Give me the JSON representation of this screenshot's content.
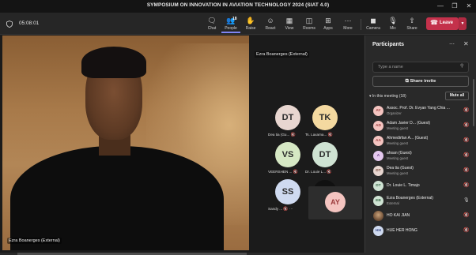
{
  "window": {
    "title": "SYMPOSIUM ON INNOVATION IN AVIATION TECHNOLOGY 2024 (SIAT 4.0)",
    "controls": [
      "—",
      "❐",
      "✕"
    ]
  },
  "toolbar": {
    "timer": "05:08:01",
    "buttons": [
      {
        "label": "Chat",
        "icon": "chat-icon"
      },
      {
        "label": "People",
        "icon": "people-icon",
        "count": "18"
      },
      {
        "label": "Raise",
        "icon": "hand-icon"
      },
      {
        "label": "React",
        "icon": "smile-icon"
      },
      {
        "label": "View",
        "icon": "view-icon"
      },
      {
        "label": "Rooms",
        "icon": "rooms-icon"
      },
      {
        "label": "Apps",
        "icon": "apps-icon"
      },
      {
        "label": "More",
        "icon": "more-icon"
      },
      {
        "label": "Camera",
        "icon": "camera-off-icon"
      },
      {
        "label": "Mic",
        "icon": "mic-off-icon"
      },
      {
        "label": "Share",
        "icon": "share-icon"
      }
    ],
    "leave_label": "Leave"
  },
  "stage": {
    "main_name": "Ezra Boanerges (External)",
    "gallery_label": "Ezra Boanerges (External)",
    "tiles": [
      {
        "initials": "DT",
        "name": "Dea tia (Gu...",
        "color": "#e8d6d0"
      },
      {
        "initials": "TK",
        "name": "Ts. Laxama...",
        "color": "#f4d9a0"
      },
      {
        "initials": "VS",
        "name": "VEERSHEN ...",
        "color": "#d6e8c4"
      },
      {
        "initials": "DT",
        "name": "Dr. Louie L...",
        "color": "#cfe3d3"
      },
      {
        "initials": "SS",
        "name": "Sandy ...",
        "color": "#cfdaf0"
      }
    ],
    "view_all": "View all",
    "self_initials": "AY"
  },
  "panel": {
    "title": "Participants",
    "search_placeholder": "Type a name",
    "share_invite": "Share invite",
    "in_meeting": "In this meeting (18)",
    "mute_all": "Mute all",
    "participants": [
      {
        "initials": "AY",
        "name": "Assoc. Prof. Dr. Evyan Yang Chia ...",
        "role": "Organizer",
        "color": "#f4c4c0",
        "fg": "#9b3b3b"
      },
      {
        "initials": "AD",
        "name": "Adam Javier D...  (Guest)",
        "role": "Meeting guest",
        "color": "#f4c4c0",
        "fg": "#9b3b3b"
      },
      {
        "initials": "AA",
        "name": "Ahmedirfan A...  (Guest)",
        "role": "Meeting guest",
        "color": "#f4c4c0",
        "fg": "#9b3b3b"
      },
      {
        "initials": "A",
        "name": "ahsan (Guest)",
        "role": "Meeting guest",
        "color": "#e4c8ee",
        "fg": "#6b3b86"
      },
      {
        "initials": "DT",
        "name": "Dea tia (Guest)",
        "role": "Meeting guest",
        "color": "#e8d6d0",
        "fg": "#7a4a3b"
      },
      {
        "initials": "DT",
        "name": "Dr. Louie L. Timajo",
        "role": "",
        "color": "#cfe3d3",
        "fg": "#3b6b4a"
      },
      {
        "initials": "EB",
        "name": "Ezra Boanerges (External)",
        "role": "External",
        "color": "#cfe3d3",
        "fg": "#3b6b4a"
      },
      {
        "initials": "",
        "name": "HO KAI JIAN",
        "role": "",
        "color": "#8a6a4a",
        "fg": "#fff",
        "photo": "photo"
      },
      {
        "initials": "HH",
        "name": "HUE HER HONG",
        "role": "",
        "color": "#cfdaf0",
        "fg": "#3b4a86"
      }
    ]
  }
}
